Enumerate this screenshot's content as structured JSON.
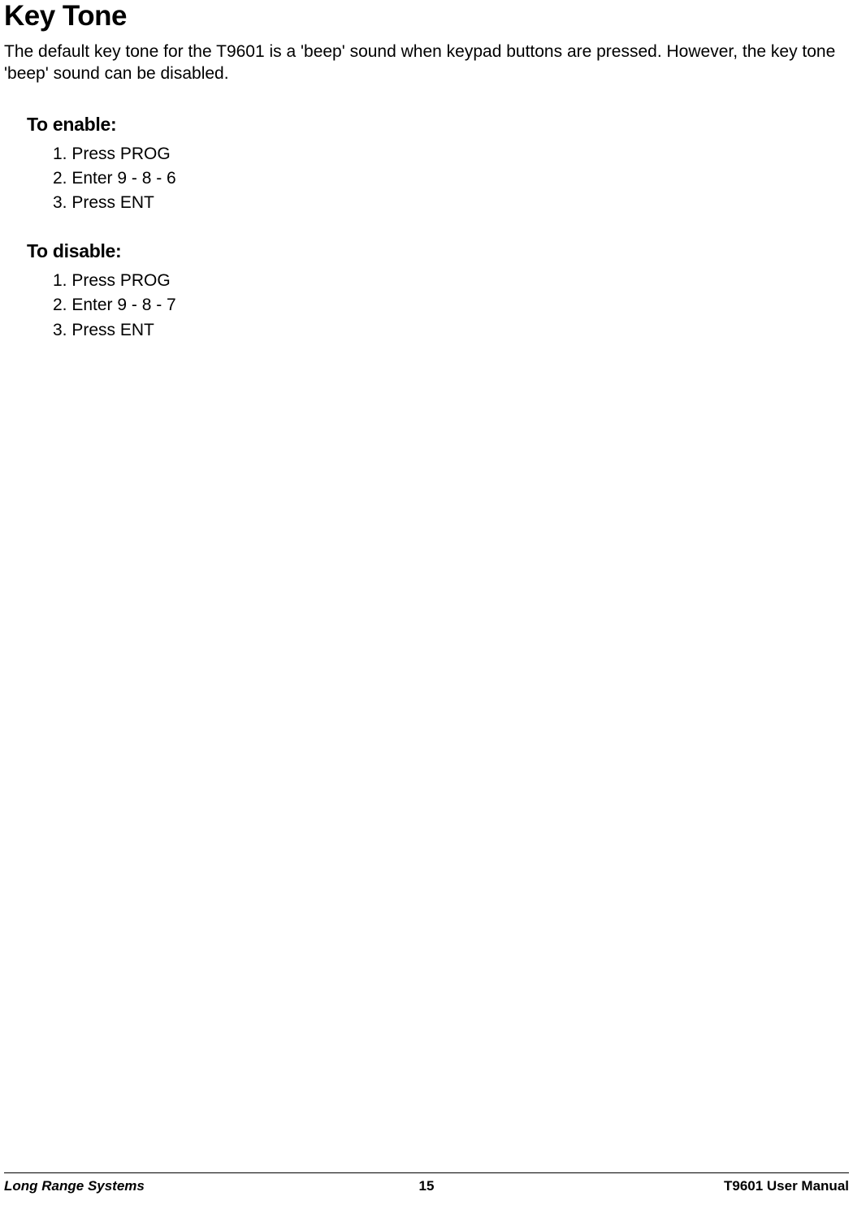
{
  "title": "Key Tone",
  "intro": "The default key tone for the T9601 is a 'beep' sound when keypad buttons are pressed. However, the key tone 'beep' sound can be disabled.",
  "sections": [
    {
      "heading": "To enable:",
      "steps": [
        "1. Press PROG",
        "2. Enter 9 - 8 - 6",
        "3. Press ENT"
      ]
    },
    {
      "heading": "To disable:",
      "steps": [
        "1. Press PROG",
        "2. Enter 9 - 8 - 7",
        "3. Press ENT"
      ]
    }
  ],
  "footer": {
    "left": "Long Range Systems",
    "center": "15",
    "right": "T9601 User Manual"
  }
}
